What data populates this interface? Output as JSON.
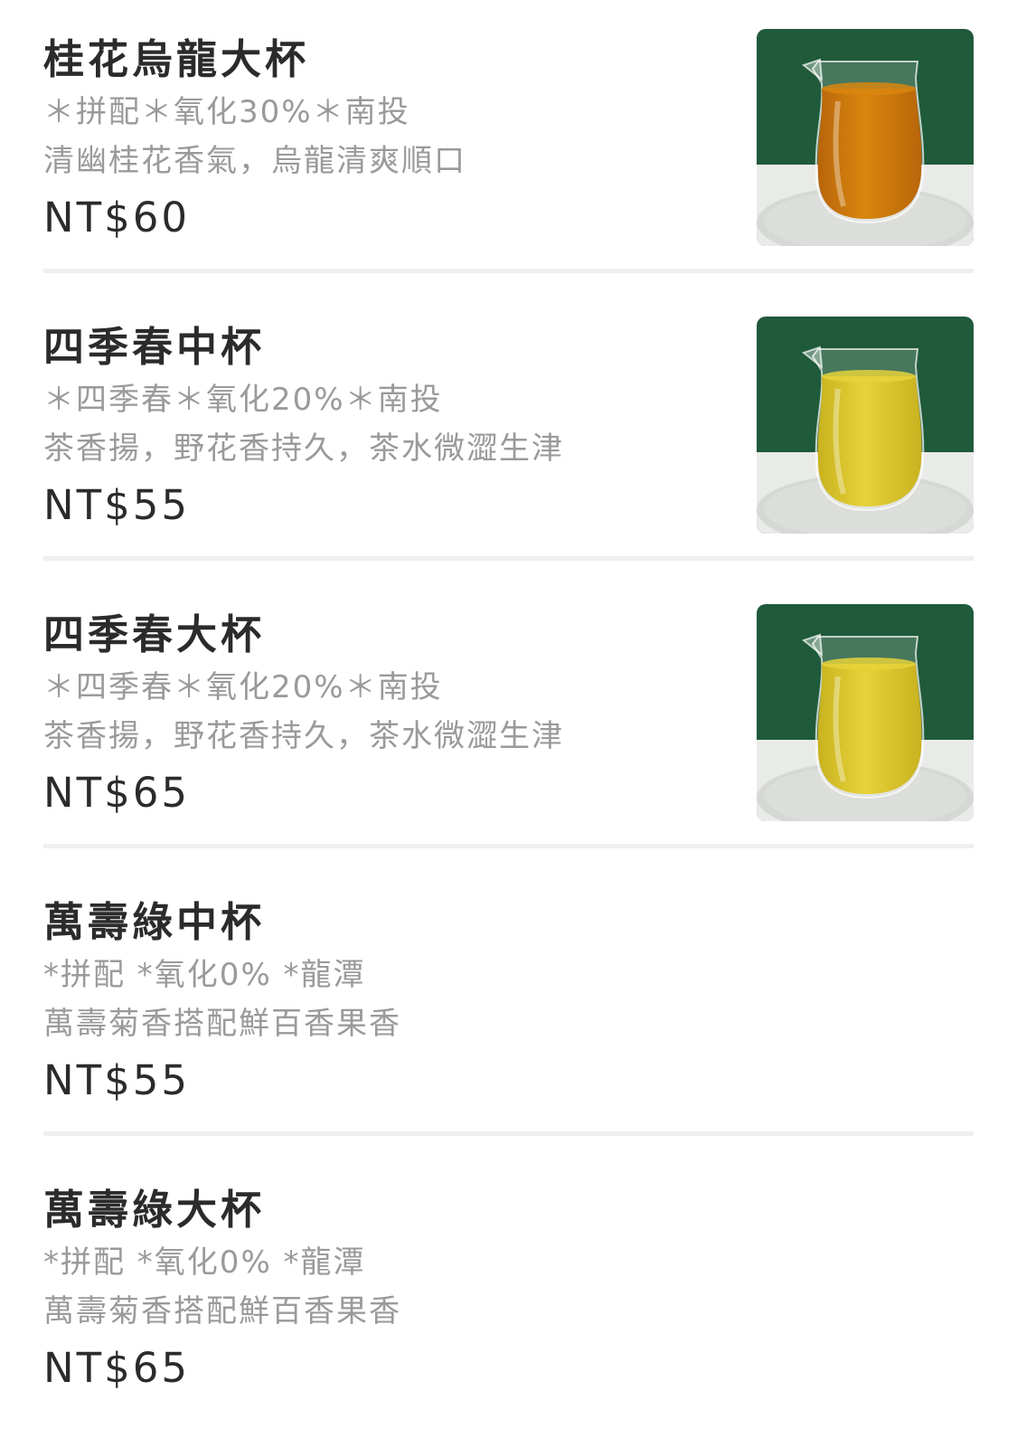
{
  "menu": {
    "items": [
      {
        "name": "桂花烏龍大杯",
        "spec": "＊拼配＊氧化30%＊南投",
        "desc": "清幽桂花香氣，烏龍清爽順口",
        "price": "NT$60",
        "photo": {
          "icon": "tea-pitcher-photo",
          "tea_color": "#d9860f",
          "tea_dark": "#b8650a"
        }
      },
      {
        "name": "四季春中杯",
        "spec": "＊四季春＊氧化20%＊南投",
        "desc": "茶香揚，野花香持久，茶水微澀生津",
        "price": "NT$55",
        "photo": {
          "icon": "tea-pitcher-photo",
          "tea_color": "#e6d23a",
          "tea_dark": "#c9b21f"
        }
      },
      {
        "name": "四季春大杯",
        "spec": "＊四季春＊氧化20%＊南投",
        "desc": "茶香揚，野花香持久，茶水微澀生津",
        "price": "NT$65",
        "photo": {
          "icon": "tea-pitcher-photo",
          "tea_color": "#e6d23a",
          "tea_dark": "#c9b21f"
        }
      },
      {
        "name": "萬壽綠中杯",
        "spec": "*拼配 *氧化0% *龍潭",
        "desc": "萬壽菊香搭配鮮百香果香",
        "price": "NT$55",
        "photo": null
      },
      {
        "name": "萬壽綠大杯",
        "spec": "*拼配 *氧化0% *龍潭",
        "desc": "萬壽菊香搭配鮮百香果香",
        "price": "NT$65",
        "photo": null
      }
    ]
  },
  "colors": {
    "photo_background": "#1f5a3a",
    "photo_table": "#e9ebe8",
    "divider": "#efefef"
  }
}
